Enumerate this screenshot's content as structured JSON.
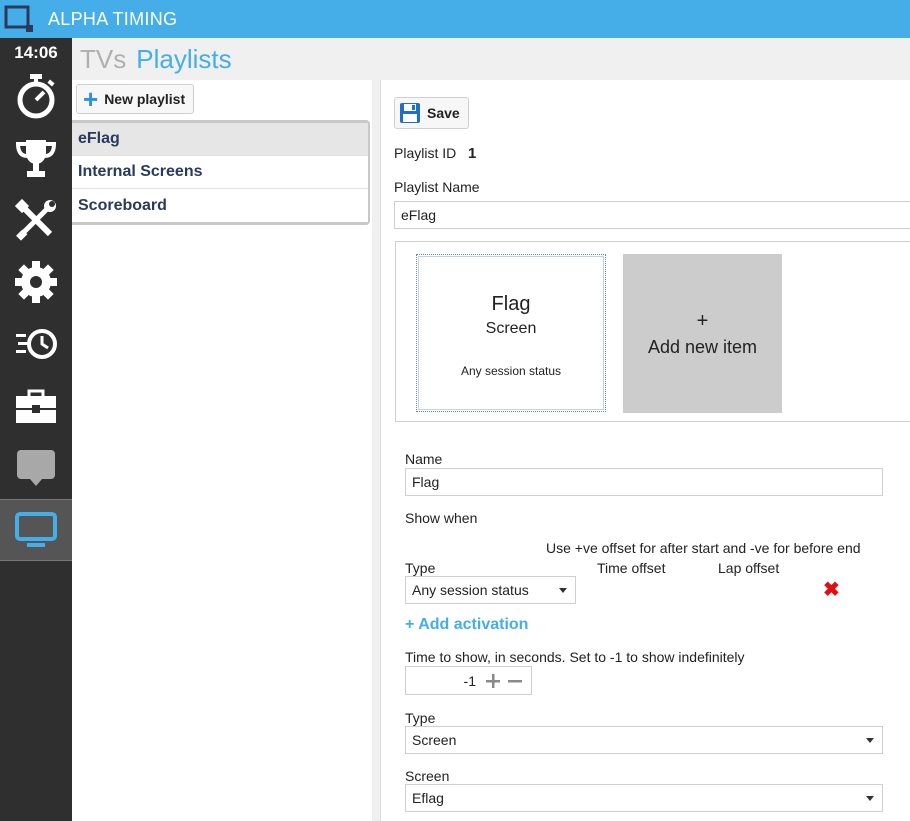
{
  "app": {
    "title": "ALPHA TIMING",
    "clock": "14:06"
  },
  "sidebar": {
    "items": [
      {
        "icon": "stopwatch-icon"
      },
      {
        "icon": "trophy-icon"
      },
      {
        "icon": "tools-icon"
      },
      {
        "icon": "gear-icon"
      },
      {
        "icon": "history-icon"
      },
      {
        "icon": "toolbox-icon"
      },
      {
        "icon": "chat-icon"
      },
      {
        "icon": "monitor-icon",
        "active": true
      }
    ]
  },
  "header": {
    "tabs": [
      {
        "label": "TVs"
      },
      {
        "label": "Playlists"
      }
    ]
  },
  "list": {
    "new_button": "New playlist",
    "playlists": [
      "eFlag",
      "Internal Screens",
      "Scoreboard"
    ]
  },
  "editor": {
    "save_label": "Save",
    "id_label": "Playlist ID",
    "id_value": "1",
    "name_label": "Playlist Name",
    "name_value": "eFlag",
    "card": {
      "name": "Flag",
      "type": "Screen",
      "status": "Any session status"
    },
    "add_card": {
      "plus": "+",
      "label": "Add new item"
    },
    "item": {
      "name_label": "Name",
      "name_value": "Flag",
      "show_when_label": "Show when",
      "offset_hint": "Use +ve offset for after start and -ve for before end",
      "type_label": "Type",
      "time_offset_label": "Time offset",
      "lap_offset_label": "Lap offset",
      "activation_type_value": "Any session status",
      "add_activation": "+ Add activation",
      "time_to_show_label": "Time to show, in seconds.  Set to -1 to show indefinitely",
      "time_to_show_value": "-1",
      "content_type_label": "Type",
      "content_type_value": "Screen",
      "screen_label": "Screen",
      "screen_value": "Eflag"
    }
  },
  "colors": {
    "accent": "#45aee8",
    "sidebar": "#2f2f2f",
    "danger": "#e01010"
  }
}
